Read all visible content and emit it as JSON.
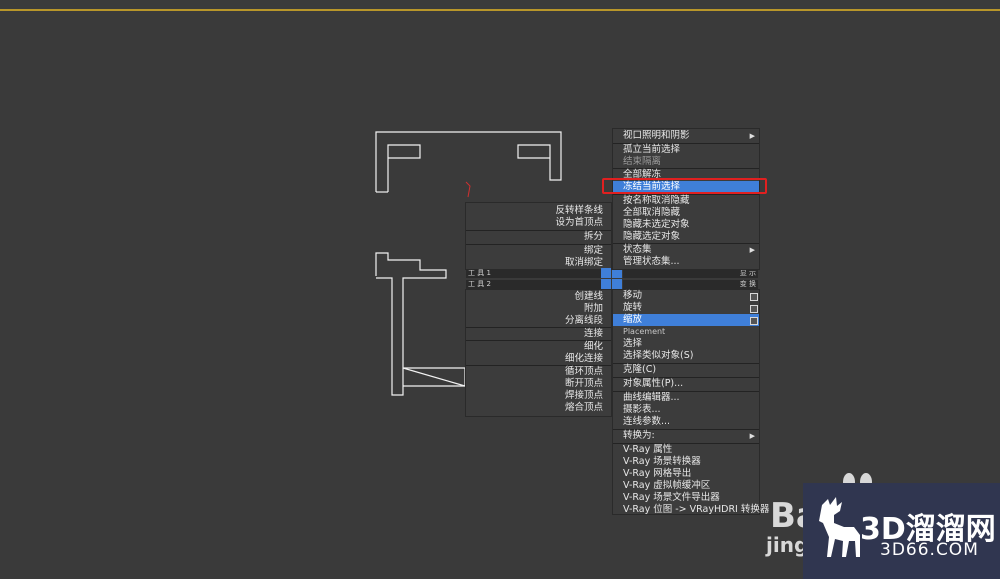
{
  "left_quad_top": {
    "items": [
      "反转样条线",
      "设为首顶点",
      "拆分",
      "绑定",
      "取消绑定"
    ]
  },
  "left_quad_bottom": {
    "items": [
      "创建线",
      "附加",
      "分离线段",
      "连接",
      "细化",
      "细化连接",
      "循环顶点",
      "断开顶点",
      "焊接顶点",
      "熔合顶点"
    ]
  },
  "quad_labels": {
    "tools1": "工 具 1",
    "tools2": "工 具 2",
    "display": "显 示",
    "transform": "变 换"
  },
  "right_quad_top": {
    "items": [
      {
        "label": "视口照明和阴影",
        "submenu": true
      },
      {
        "label": "孤立当前选择"
      },
      {
        "label": "结束隔离",
        "dim": true
      },
      {
        "label": "全部解冻"
      },
      {
        "label": "冻结当前选择",
        "highlight": true
      },
      {
        "label": "按名称取消隐藏"
      },
      {
        "label": "全部取消隐藏"
      },
      {
        "label": "隐藏未选定对象"
      },
      {
        "label": "隐藏选定对象"
      },
      {
        "label": "状态集",
        "submenu": true
      },
      {
        "label": "管理状态集..."
      }
    ]
  },
  "right_quad_bottom": {
    "items": [
      {
        "label": "移动"
      },
      {
        "label": "旋转"
      },
      {
        "label": "缩放",
        "highlight": true
      },
      {
        "label": "Placement",
        "small": true
      },
      {
        "label": "选择"
      },
      {
        "label": "选择类似对象(S)"
      },
      {
        "label": "克隆(C)"
      },
      {
        "label": "对象属性(P)..."
      },
      {
        "label": "曲线编辑器..."
      },
      {
        "label": "摄影表..."
      },
      {
        "label": "连线参数..."
      },
      {
        "label": "转换为:",
        "submenu": true
      },
      {
        "label": "V-Ray 属性"
      },
      {
        "label": "V-Ray 场景转换器"
      },
      {
        "label": "V-Ray 网格导出"
      },
      {
        "label": "V-Ray 虚拟帧缓冲区"
      },
      {
        "label": "V-Ray 场景文件导出器"
      },
      {
        "label": "V-Ray 位图 -> VRayHDRI 转换器"
      }
    ]
  },
  "watermark": {
    "site_name": "3D溜溜网",
    "site_domain": "3D66.COM",
    "baidu_text": "Ba",
    "jing_text": "jing"
  },
  "colors": {
    "highlight": "#3f7fd9",
    "annotation_box": "#e02020",
    "background": "#3a3a3a"
  }
}
